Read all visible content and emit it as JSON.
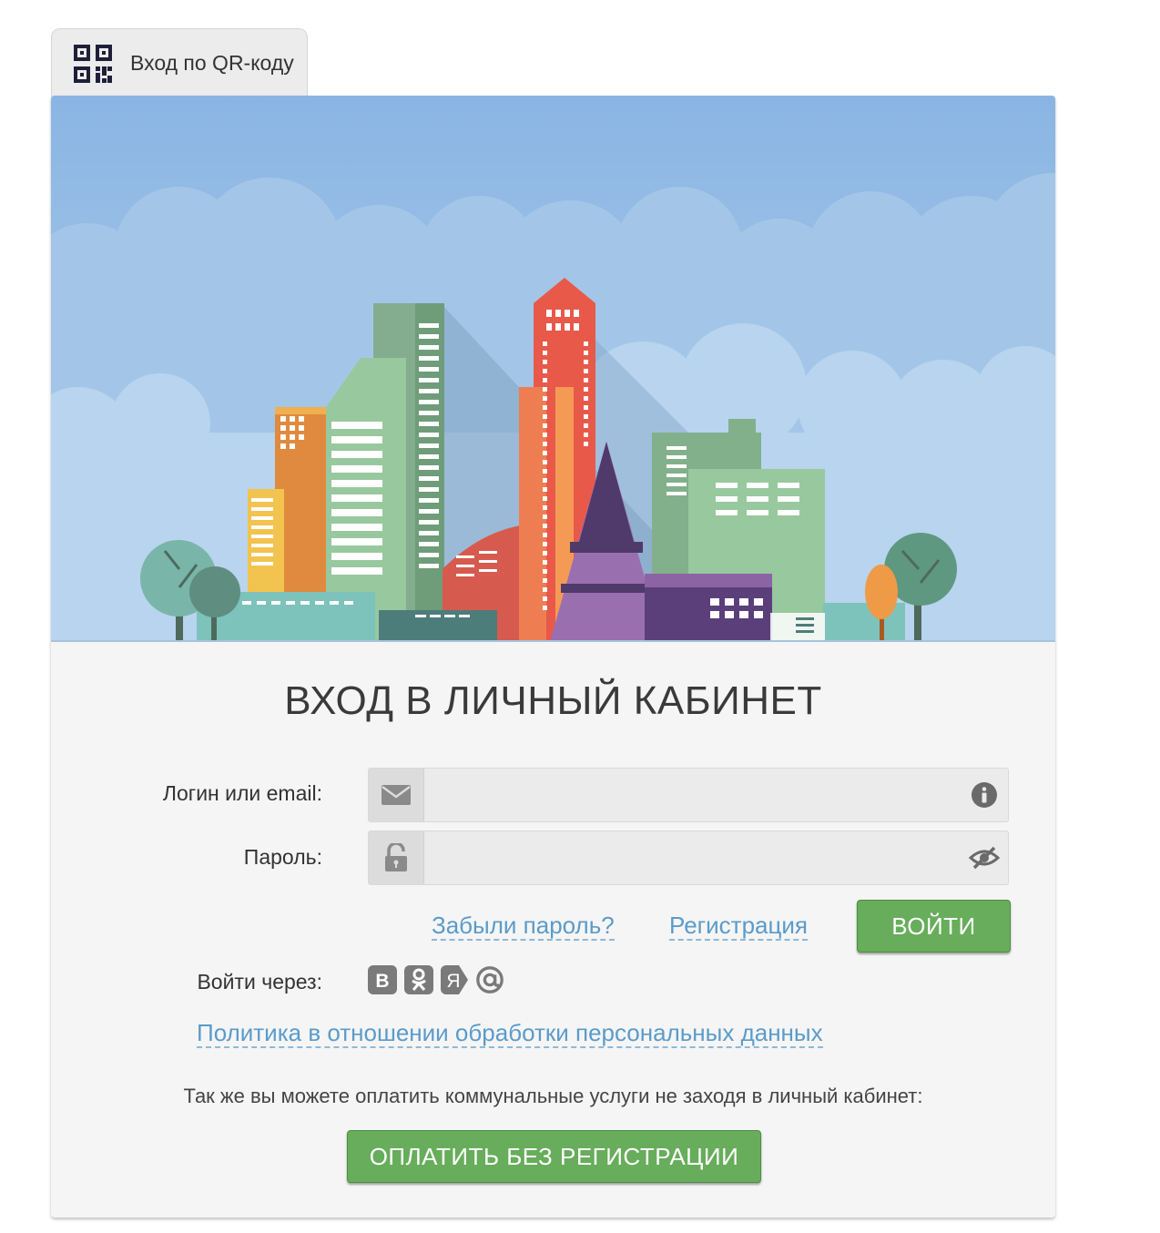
{
  "qr_tab": {
    "label": "Вход по QR-коду",
    "icon": "qr-code-icon"
  },
  "login": {
    "title": "ВХОД В ЛИЧНЫЙ КАБИНЕТ",
    "login_label": "Логин или email:",
    "login_value": "",
    "password_label": "Пароль:",
    "password_value": "",
    "forgot_link": "Забыли пароль?",
    "register_link": "Регистрация",
    "submit_button": "ВОЙТИ",
    "social_label": "Войти через:",
    "social": [
      {
        "name": "vk",
        "glyph": "В"
      },
      {
        "name": "odnoklassniki",
        "glyph": "ok"
      },
      {
        "name": "yandex",
        "glyph": "Я"
      },
      {
        "name": "mail",
        "glyph": "@"
      }
    ],
    "privacy_link": "Политика в отношении обработки персональных данных",
    "pay_text": "Так же вы можете оплатить коммунальные услуги не заходя в личный кабинет:",
    "pay_button": "ОПЛАТИТЬ БЕЗ РЕГИСТРАЦИИ"
  },
  "colors": {
    "accent_green": "#67ad5b",
    "link_blue": "#5b9bc9",
    "sky": "#8db8e3"
  }
}
